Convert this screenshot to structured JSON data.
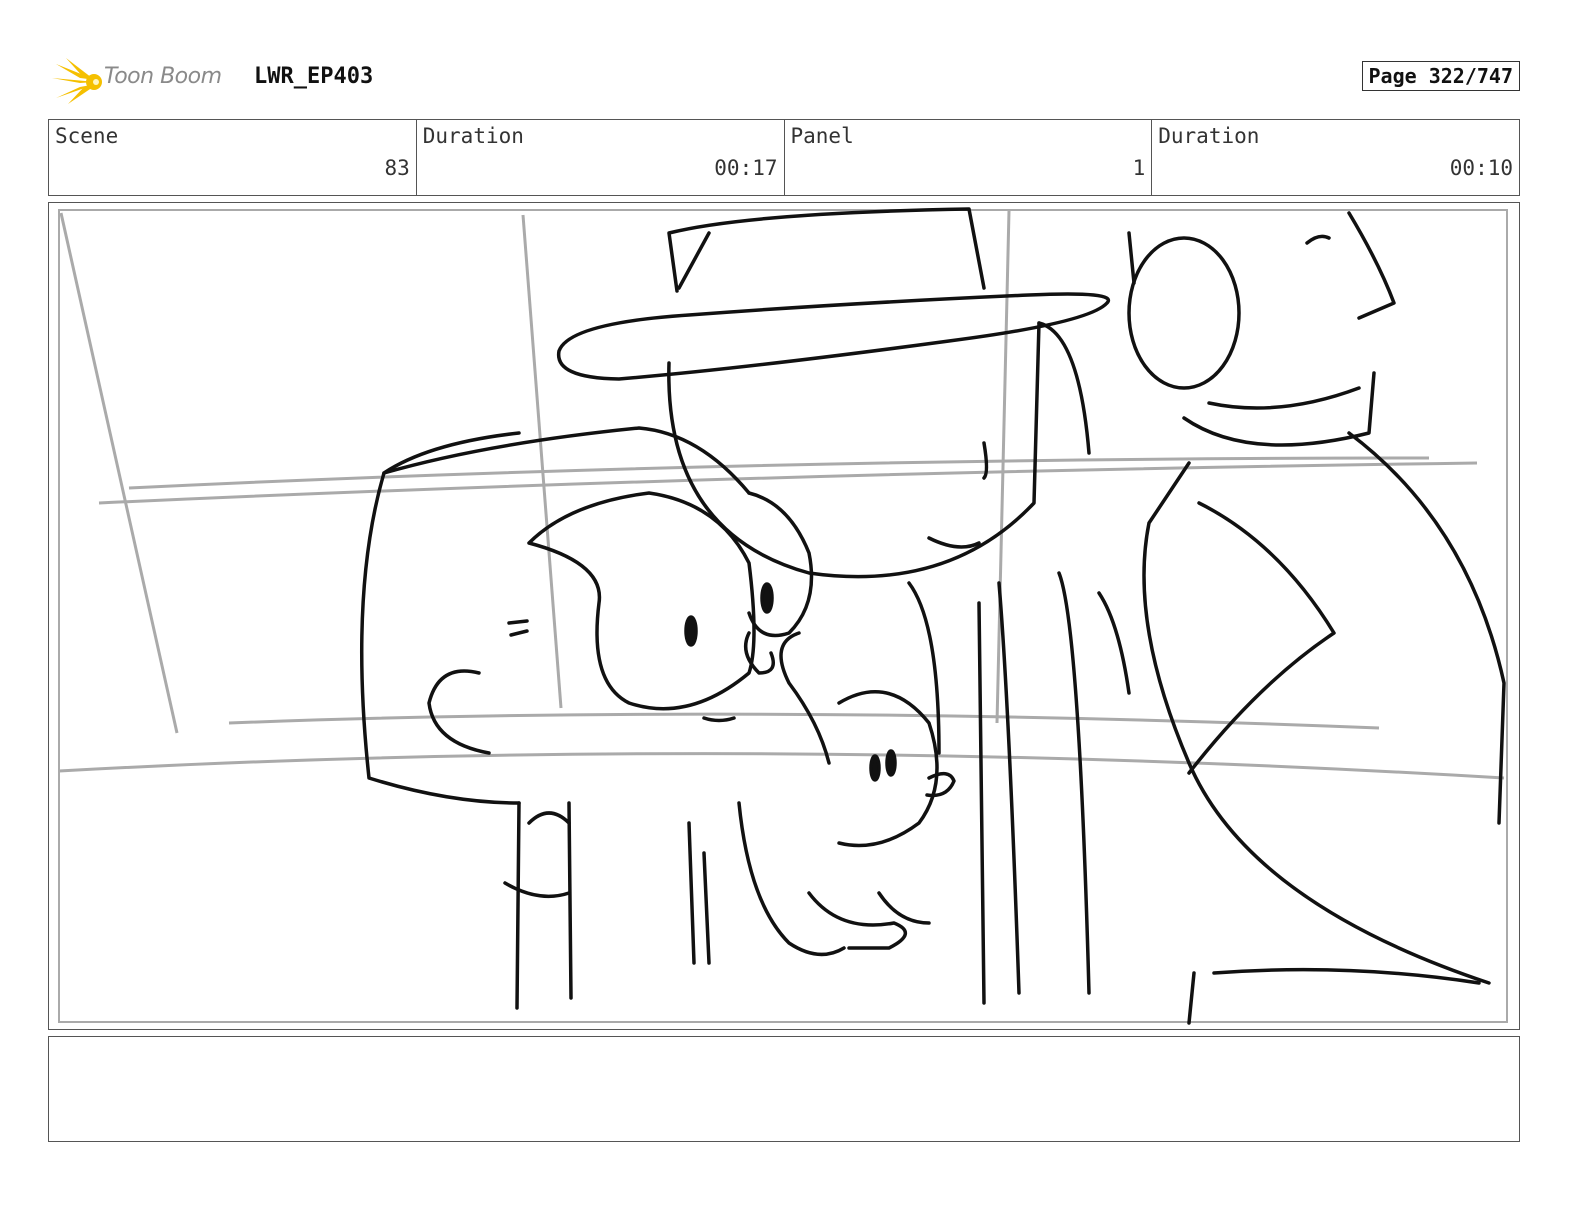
{
  "header": {
    "brand": "Toon Boom",
    "project": "LWR_EP403",
    "page": "Page 322/747",
    "logo_color": "#f5c000"
  },
  "info": {
    "scene_label": "Scene",
    "scene_value": "83",
    "scene_duration_label": "Duration",
    "scene_duration_value": "00:17",
    "panel_label": "Panel",
    "panel_value": "1",
    "panel_duration_label": "Duration",
    "panel_duration_value": "00:10"
  },
  "panel": {
    "icon": "storyboard-sketch",
    "stroke_color": "#111111",
    "guide_color": "#aaaaaa"
  },
  "notes": {
    "text": ""
  }
}
